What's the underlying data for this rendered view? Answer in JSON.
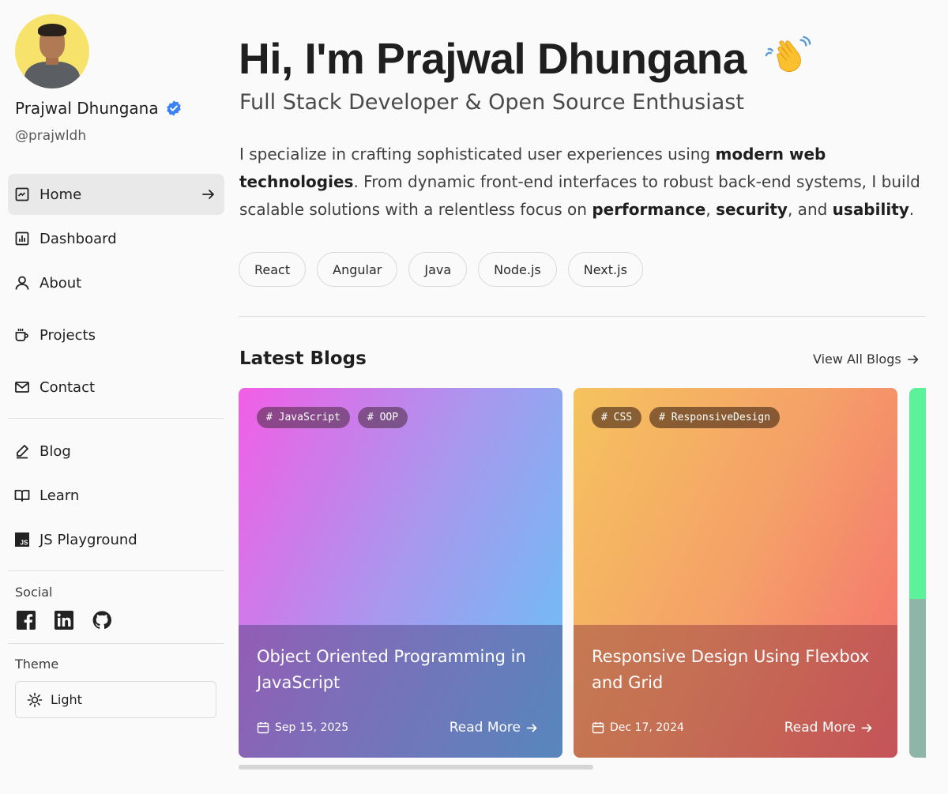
{
  "profile": {
    "name": "Prajwal Dhungana",
    "handle": "@prajwldh"
  },
  "nav": {
    "items": [
      {
        "label": "Home",
        "icon": "home-icon",
        "active": true
      },
      {
        "label": "Dashboard",
        "icon": "dashboard-icon"
      },
      {
        "label": "About",
        "icon": "user-icon"
      },
      {
        "label": "Projects",
        "icon": "cup-icon"
      },
      {
        "label": "Contact",
        "icon": "mail-icon"
      },
      {
        "label": "Blog",
        "icon": "pencil-icon"
      },
      {
        "label": "Learn",
        "icon": "book-icon"
      },
      {
        "label": "JS Playground",
        "icon": "js-icon"
      }
    ]
  },
  "social": {
    "label": "Social",
    "icons": [
      "facebook-icon",
      "linkedin-icon",
      "github-icon"
    ]
  },
  "theme": {
    "label": "Theme",
    "value": "Light"
  },
  "hero": {
    "title": "Hi, I'm Prajwal Dhungana",
    "subtitle": "Full Stack Developer & Open Source Enthusiast",
    "desc_1": "I specialize in crafting sophisticated user experiences using ",
    "desc_bold_1": "modern web technologies",
    "desc_2": ". From dynamic front-end interfaces to robust back-end systems, I build scalable solutions with a relentless focus on ",
    "desc_bold_2": "performance",
    "desc_3": ", ",
    "desc_bold_3": "security",
    "desc_4": ", and ",
    "desc_bold_4": "usability",
    "desc_5": "."
  },
  "skills": [
    "React",
    "Angular",
    "Java",
    "Node.js",
    "Next.js"
  ],
  "blogs": {
    "title": "Latest Blogs",
    "view_all": "View All Blogs",
    "cards": [
      {
        "tags": [
          "# JavaScript",
          "# OOP"
        ],
        "title": "Object Oriented Programming in JavaScript",
        "date": "Sep 15, 2025",
        "read_more": "Read More"
      },
      {
        "tags": [
          "# CSS",
          "# ResponsiveDesign"
        ],
        "title": "Responsive Design Using Flexbox and Grid",
        "date": "Dec 17, 2024",
        "read_more": "Read More"
      }
    ]
  },
  "colors": {
    "verified": "#3b82f6",
    "card1_gradient": [
      "#f25ee6",
      "#a898ee",
      "#64c4f6"
    ],
    "card2_gradient": [
      "#f5c35e",
      "#f5a168",
      "#f46f6f"
    ],
    "card3_gradient": [
      "#5cf29a",
      "#8fb5a8"
    ]
  }
}
